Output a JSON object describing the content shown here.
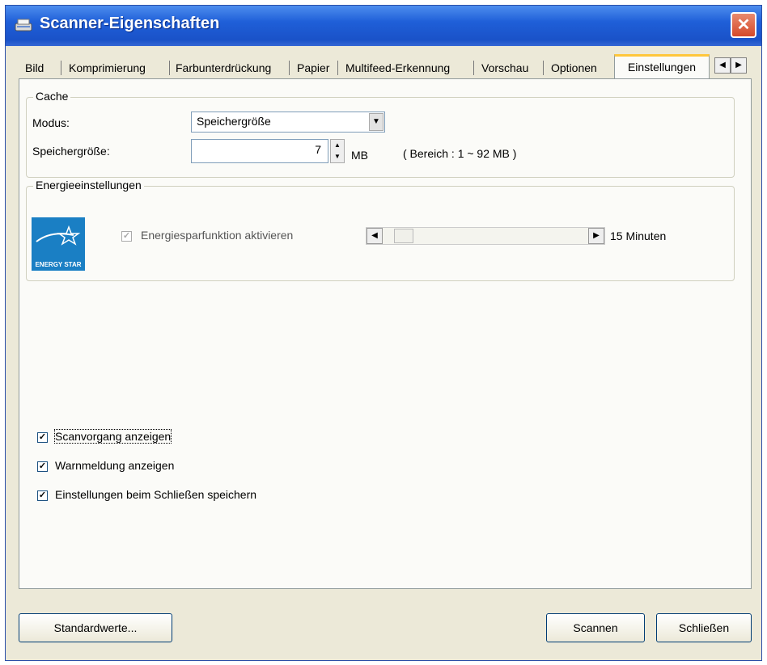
{
  "window": {
    "title": "Scanner-Eigenschaften",
    "close_label": "✕"
  },
  "tabs": [
    "Bild",
    "Komprimierung",
    "Farbunterdrückung",
    "Papier",
    "Multifeed-Erkennung",
    "Vorschau",
    "Optionen",
    "Einstellungen"
  ],
  "active_tab": "Einstellungen",
  "tab_scroll": {
    "left": "◀",
    "right": "▶"
  },
  "cache": {
    "title": "Cache",
    "modus_label": "Modus:",
    "modus_value": "Speichergröße",
    "speicher_label": "Speichergröße:",
    "speicher_value": "7",
    "unit": "MB",
    "range": "( Bereich : 1 ~ 92 MB )"
  },
  "energy": {
    "title": "Energieeinstellungen",
    "logo_text": "ENERGY STAR",
    "checkbox_label": "Energiesparfunktion aktivieren",
    "checkbox_checked": true,
    "slider_value_label": "15 Minuten",
    "slider_fraction": 0.0
  },
  "options": [
    {
      "label": "Scanvorgang anzeigen",
      "checked": true
    },
    {
      "label": "Warnmeldung anzeigen",
      "checked": true
    },
    {
      "label": "Einstellungen beim Schließen speichern",
      "checked": true
    }
  ],
  "buttons": {
    "defaults": "Standardwerte...",
    "scan": "Scannen",
    "close": "Schließen"
  },
  "icons": {
    "combo_arrow": "▼",
    "spin_up": "▲",
    "spin_down": "▼",
    "check": "✓",
    "scroll_left": "◀",
    "scroll_right": "▶"
  }
}
